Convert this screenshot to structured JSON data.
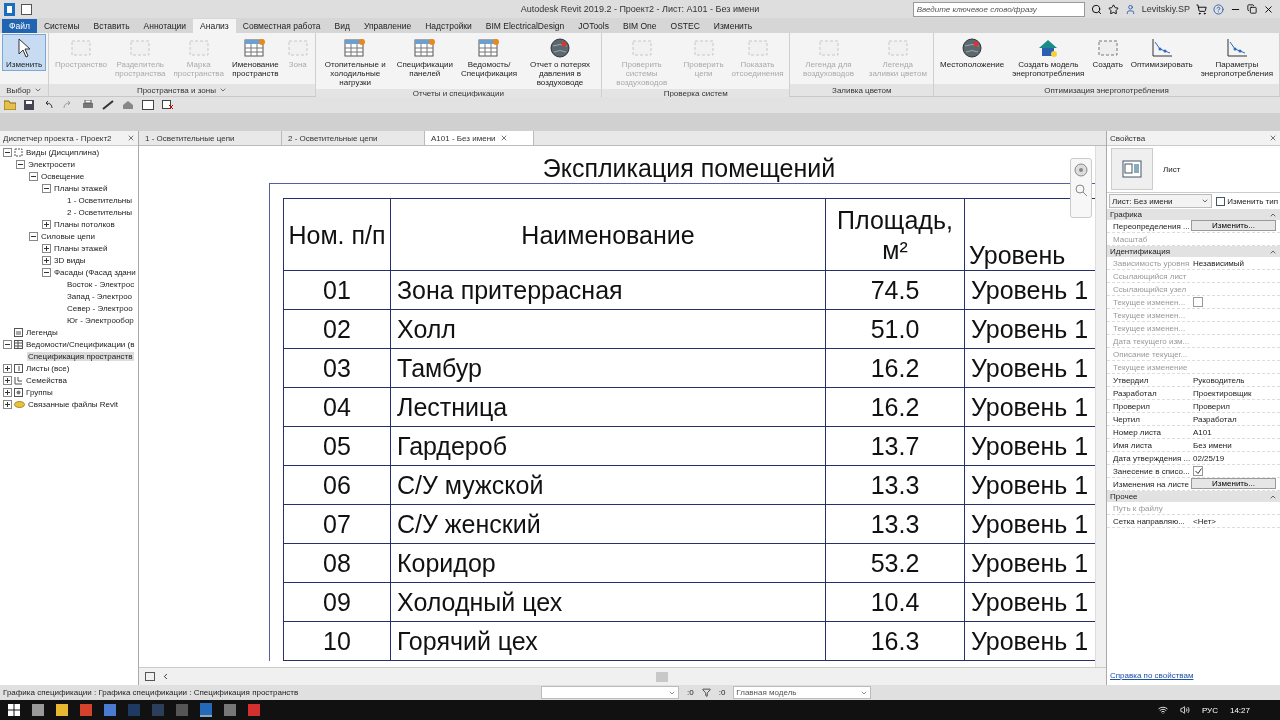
{
  "title_bar": {
    "title": "Autodesk Revit 2019.2 - Проект2 - Лист: A101 - Без имени",
    "search": {
      "placeholder": "Введите ключевое слово/фразу"
    },
    "user": "Levitskiy.SP"
  },
  "ribbon_tabs": [
    {
      "label": "Файл",
      "kind": "file",
      "selected": false
    },
    {
      "label": "Системы",
      "kind": "tab",
      "selected": false
    },
    {
      "label": "Вставить",
      "kind": "tab",
      "selected": false
    },
    {
      "label": "Аннотации",
      "kind": "tab",
      "selected": false
    },
    {
      "label": "Анализ",
      "kind": "tab",
      "selected": true
    },
    {
      "label": "Совместная работа",
      "kind": "tab",
      "selected": false
    },
    {
      "label": "Вид",
      "kind": "tab",
      "selected": false
    },
    {
      "label": "Управление",
      "kind": "tab",
      "selected": false
    },
    {
      "label": "Надстройки",
      "kind": "tab",
      "selected": false
    },
    {
      "label": "BIM ElectricalDesign",
      "kind": "tab",
      "selected": false
    },
    {
      "label": "JOTools",
      "kind": "tab",
      "selected": false
    },
    {
      "label": "BIM One",
      "kind": "tab",
      "selected": false
    },
    {
      "label": "OSTEC",
      "kind": "tab",
      "selected": false
    },
    {
      "label": "Изменить",
      "kind": "tab",
      "selected": false
    }
  ],
  "ribbon_groups": [
    {
      "title": "Выбор",
      "dropdown": true,
      "tools": [
        {
          "label": "Изменить",
          "kind": "cursor",
          "active": true,
          "disabled": false
        }
      ]
    },
    {
      "title": "Пространства и зоны",
      "dropdown": true,
      "tools": [
        {
          "label": "Пространство",
          "kind": "frame",
          "active": false,
          "disabled": true
        },
        {
          "label": "Разделитель пространства",
          "kind": "frame",
          "active": false,
          "disabled": true
        },
        {
          "label": "Марка пространства",
          "kind": "frame",
          "active": false,
          "disabled": true
        },
        {
          "label": "Именование пространств",
          "kind": "table",
          "active": false,
          "disabled": false
        },
        {
          "label": "Зона",
          "kind": "frame",
          "active": false,
          "disabled": true
        }
      ]
    },
    {
      "title": "Отчеты и спецификации",
      "dropdown": false,
      "tools": [
        {
          "label": "Отопительные и холодильные нагрузки",
          "kind": "table",
          "active": false,
          "disabled": false
        },
        {
          "label": "Спецификации панелей",
          "kind": "table",
          "active": false,
          "disabled": false
        },
        {
          "label": "Ведомость/ Спецификация",
          "kind": "table",
          "active": false,
          "disabled": false
        },
        {
          "label": "Отчет о потерях давления в воздуховоде",
          "kind": "globe",
          "active": false,
          "disabled": false
        }
      ]
    },
    {
      "title": "Проверка систем",
      "dropdown": false,
      "tools": [
        {
          "label": "Проверить системы воздуховодов",
          "kind": "frame",
          "active": false,
          "disabled": true
        },
        {
          "label": "Проверить цепи",
          "kind": "frame",
          "active": false,
          "disabled": true
        },
        {
          "label": "Показать отсоединения",
          "kind": "frame",
          "active": false,
          "disabled": true
        }
      ]
    },
    {
      "title": "Заливка цветом",
      "dropdown": false,
      "tools": [
        {
          "label": "Легенда для воздуховодов",
          "kind": "frame",
          "active": false,
          "disabled": true
        },
        {
          "label": "Легенда заливки цветом",
          "kind": "frame",
          "active": false,
          "disabled": true
        }
      ]
    },
    {
      "title": "Оптимизация энергопотребления",
      "dropdown": false,
      "tools": [
        {
          "label": "Местоположение",
          "kind": "globe",
          "active": false,
          "disabled": false
        },
        {
          "label": "Создать модель энергопотребления",
          "kind": "house",
          "active": false,
          "disabled": false
        },
        {
          "label": "Создать",
          "kind": "frame",
          "active": false,
          "disabled": false
        },
        {
          "label": "Оптимизировать",
          "kind": "chart",
          "active": false,
          "disabled": false
        },
        {
          "label": "Параметры энергопотребления",
          "kind": "chart",
          "active": false,
          "disabled": false
        }
      ]
    }
  ],
  "project_browser": {
    "title": "Диспетчер проекта - Проект2",
    "tree": [
      {
        "label": "Виды (Дисциплина)",
        "kind": "views",
        "expanded": true,
        "selected": false,
        "children": [
          {
            "label": "Электросети",
            "expanded": true,
            "selected": false,
            "children": [
              {
                "label": "Освещение",
                "expanded": true,
                "selected": false,
                "children": [
                  {
                    "label": "Планы этажей",
                    "expanded": true,
                    "selected": false,
                    "children": [
                      {
                        "label": "1 - Осветительны",
                        "selected": false
                      },
                      {
                        "label": "2 - Осветительны",
                        "selected": false
                      }
                    ]
                  },
                  {
                    "label": "Планы потолков",
                    "expanded": false,
                    "selected": false
                  }
                ]
              },
              {
                "label": "Силовые цепи",
                "expanded": true,
                "selected": false,
                "children": [
                  {
                    "label": "Планы этажей",
                    "expanded": false,
                    "selected": false
                  },
                  {
                    "label": "3D виды",
                    "expanded": false,
                    "selected": false
                  },
                  {
                    "label": "Фасады (Фасад здани",
                    "expanded": true,
                    "selected": false,
                    "children": [
                      {
                        "label": "Восток - Электрос",
                        "selected": false
                      },
                      {
                        "label": "Запад - Электроо",
                        "selected": false
                      },
                      {
                        "label": "Север - Электроо",
                        "selected": false
                      },
                      {
                        "label": "Юг - Электрообор",
                        "selected": false
                      }
                    ]
                  }
                ]
              }
            ]
          }
        ]
      },
      {
        "label": "Легенды",
        "kind": "legend",
        "selected": false
      },
      {
        "label": "Ведомости/Спецификации (в",
        "kind": "schedule",
        "expanded": true,
        "selected": false,
        "children": [
          {
            "label": "Спецификация пространств",
            "selected": true
          }
        ]
      },
      {
        "label": "Листы (все)",
        "kind": "sheets",
        "expanded": false,
        "selected": false
      },
      {
        "label": "Семейства",
        "kind": "families",
        "expanded": false,
        "selected": false
      },
      {
        "label": "Группы",
        "kind": "groups",
        "expanded": false,
        "selected": false
      },
      {
        "label": "Связанные файлы Revit",
        "kind": "links",
        "expanded": false,
        "selected": false
      }
    ]
  },
  "view_tabs": [
    {
      "label": "1 - Осветительные цепи",
      "selected": false
    },
    {
      "label": "2 - Осветительные цепи",
      "selected": false
    },
    {
      "label": "A101 - Без имени",
      "selected": true
    }
  ],
  "schedule": {
    "title": "Экспликация помещений",
    "columns": [
      "Ном. п/п",
      "Наименование",
      "Площадь, м²",
      "Уровень"
    ],
    "rows": [
      [
        "01",
        "Зона притеррасная",
        "74.5",
        "Уровень 1"
      ],
      [
        "02",
        "Холл",
        "51.0",
        "Уровень 1"
      ],
      [
        "03",
        "Тамбур",
        "16.2",
        "Уровень 1"
      ],
      [
        "04",
        "Лестница",
        "16.2",
        "Уровень 1"
      ],
      [
        "05",
        "Гардероб",
        "13.7",
        "Уровень 1"
      ],
      [
        "06",
        "С/У мужской",
        "13.3",
        "Уровень 1"
      ],
      [
        "07",
        "С/У женский",
        "13.3",
        "Уровень 1"
      ],
      [
        "08",
        "Коридор",
        "53.2",
        "Уровень 1"
      ],
      [
        "09",
        "Холодный цех",
        "10.4",
        "Уровень 1"
      ],
      [
        "10",
        "Горячий цех",
        "16.3",
        "Уровень 1"
      ]
    ]
  },
  "properties": {
    "title": "Свойства",
    "type": "Лист",
    "selector": "Лист: Без имени",
    "edit_type": "Изменить тип",
    "sections": [
      {
        "title": "Графика",
        "rows": [
          {
            "label": "Переопределения ...",
            "kind": "button",
            "value": "Изменить...",
            "disabled": false
          },
          {
            "label": "Масштаб",
            "kind": "text",
            "disabled": true
          }
        ]
      },
      {
        "title": "Идентификация",
        "rows": [
          {
            "label": "Зависимость уровня",
            "kind": "text",
            "value": "Независимый",
            "disabled": true
          },
          {
            "label": "Ссылающийся лист",
            "kind": "text",
            "disabled": true
          },
          {
            "label": "Ссылающийся узел",
            "kind": "text",
            "disabled": true
          },
          {
            "label": "Текущее изменен...",
            "kind": "checkbox",
            "checked": false,
            "disabled": true
          },
          {
            "label": "Текущее изменен...",
            "kind": "text",
            "disabled": true
          },
          {
            "label": "Текущее изменен...",
            "kind": "text",
            "disabled": true
          },
          {
            "label": "Дата текущего изм...",
            "kind": "text",
            "disabled": true
          },
          {
            "label": "Описание текущег...",
            "kind": "text",
            "disabled": true
          },
          {
            "label": "Текущее изменение",
            "kind": "text",
            "disabled": true
          },
          {
            "label": "Утвердил",
            "kind": "text",
            "value": "Руководитель",
            "disabled": false
          },
          {
            "label": "Разработал",
            "kind": "text",
            "value": "Проектировщик",
            "disabled": false
          },
          {
            "label": "Проверил",
            "kind": "text",
            "value": "Проверил",
            "disabled": false
          },
          {
            "label": "Чертил",
            "kind": "text",
            "value": "Разработал",
            "disabled": false
          },
          {
            "label": "Номер листа",
            "kind": "text",
            "value": "A101",
            "disabled": false
          },
          {
            "label": "Имя листа",
            "kind": "text",
            "value": "Без имени",
            "disabled": false
          },
          {
            "label": "Дата утверждения ...",
            "kind": "text",
            "value": "02/25/19",
            "disabled": false
          },
          {
            "label": "Занесение в списо...",
            "kind": "checkbox",
            "checked": true,
            "disabled": false
          },
          {
            "label": "Изменения на листе",
            "kind": "button",
            "value": "Изменить...",
            "disabled": false
          }
        ]
      },
      {
        "title": "Прочее",
        "rows": [
          {
            "label": "Путь к файлу",
            "kind": "text",
            "disabled": true
          },
          {
            "label": "Сетка направляю...",
            "kind": "text",
            "value": "<Нет>",
            "disabled": false
          }
        ]
      }
    ],
    "help_link": "Справка по свойствам"
  },
  "status_bar": {
    "text": "Графика спецификации : Графика спецификации : Спецификация пространств",
    "counter_1": ":0",
    "counter_2": ":0",
    "model": "Главная модель"
  },
  "taskbar": {
    "language": "РУС",
    "time": "14:27"
  }
}
